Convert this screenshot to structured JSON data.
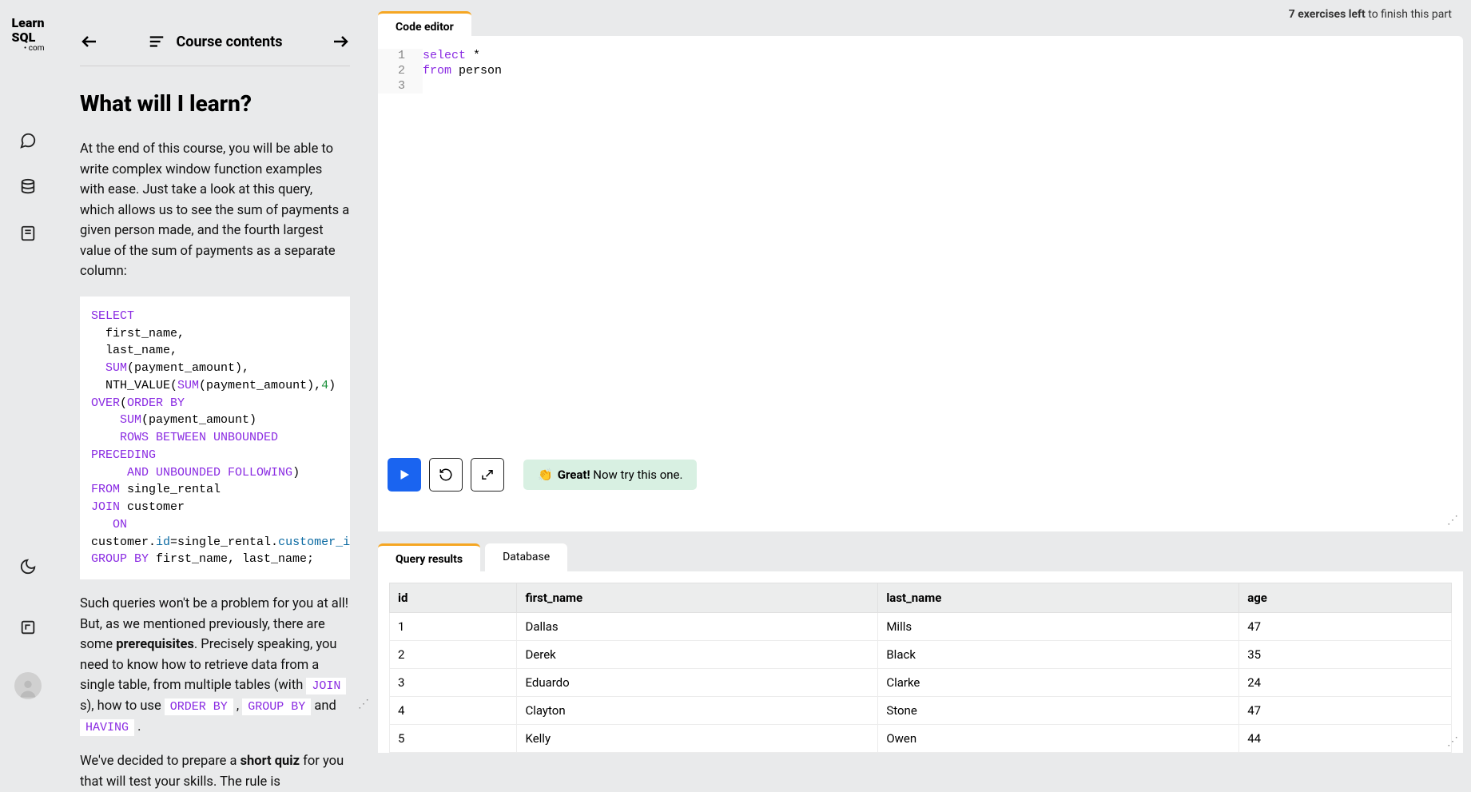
{
  "logo": {
    "line1": "Learn",
    "line2": "SQL",
    "dotcom": "• com"
  },
  "header": {
    "exercises_left_count": "7 exercises left",
    "suffix": " to finish this part"
  },
  "toc": {
    "label": "Course contents"
  },
  "lesson": {
    "title": "What will I learn?",
    "para1": "At the end of this course, you will be able to write complex window function examples with ease. Just take a look at this query, which allows us to see the sum of payments a given person made, and the fourth largest value of the sum of payments as a separate column:",
    "para2a": "Such queries won't be a problem for you at all! But, as we mentioned previously, there are some ",
    "para2b": "prerequisites",
    "para2c": ". Precisely speaking, you need to know how to retrieve data from a single table, from multiple tables (with ",
    "join": "JOIN",
    "para2d": " s), how to use ",
    "orderby": "ORDER BY",
    "para2e": " , ",
    "groupby": "GROUP BY",
    "para2f": " and ",
    "having": "HAVING",
    "para2g": " .",
    "para3a": "We've decided to prepare a ",
    "para3b": "short quiz",
    "para3c": " for you that will test your skills. The rule is"
  },
  "sql_example": {
    "l1_kw": "SELECT",
    "l2": "  first_name,",
    "l3": "  last_name,",
    "l4a": "  ",
    "l4_kw": "SUM",
    "l4b": "(payment_amount),",
    "l5a": "  NTH_VALUE(",
    "l5_kw": "SUM",
    "l5b": "(payment_amount),",
    "l5_num": "4",
    "l5c": ")",
    "l6_kw": "OVER",
    "l6a": "(",
    "l6_kw2": "ORDER BY",
    "l7a": "    ",
    "l7_kw": "SUM",
    "l7b": "(payment_amount)",
    "l8a": "    ",
    "l8_kw": "ROWS BETWEEN UNBOUNDED",
    "l8b_kw": "PRECEDING",
    "l9a": "     ",
    "l9_kw": "AND UNBOUNDED FOLLOWING",
    "l9b": ")",
    "l10_kw": "FROM",
    "l10a": " single_rental",
    "l11_kw": "JOIN",
    "l11a": " customer",
    "l12a": "   ",
    "l12_kw": "ON",
    "l13a": "customer.",
    "l13_col1": "id",
    "l13b": "=single_rental.",
    "l13_col2": "customer_id",
    "l14_kw": "GROUP BY",
    "l14a": " first_name, last_name;"
  },
  "editor": {
    "tab": "Code editor",
    "lines": {
      "n1": "1",
      "n2": "2",
      "n3": "3"
    },
    "code_l1_kw": "select",
    "code_l1_rest": " *",
    "code_l2_kw": "from",
    "code_l2_rest": " person"
  },
  "feedback": {
    "emoji": "👏",
    "strong": "Great!",
    "rest": " Now try this one."
  },
  "results": {
    "tab_active": "Query results",
    "tab_inactive": "Database",
    "columns": {
      "c1": "id",
      "c2": "first_name",
      "c3": "last_name",
      "c4": "age"
    },
    "rows": [
      {
        "id": "1",
        "first_name": "Dallas",
        "last_name": "Mills",
        "age": "47"
      },
      {
        "id": "2",
        "first_name": "Derek",
        "last_name": "Black",
        "age": "35"
      },
      {
        "id": "3",
        "first_name": "Eduardo",
        "last_name": "Clarke",
        "age": "24"
      },
      {
        "id": "4",
        "first_name": "Clayton",
        "last_name": "Stone",
        "age": "47"
      },
      {
        "id": "5",
        "first_name": "Kelly",
        "last_name": "Owen",
        "age": "44"
      }
    ]
  },
  "chart_data": {
    "type": "table",
    "title": "Query results",
    "columns": [
      "id",
      "first_name",
      "last_name",
      "age"
    ],
    "rows": [
      [
        1,
        "Dallas",
        "Mills",
        47
      ],
      [
        2,
        "Derek",
        "Black",
        35
      ],
      [
        3,
        "Eduardo",
        "Clarke",
        24
      ],
      [
        4,
        "Clayton",
        "Stone",
        47
      ],
      [
        5,
        "Kelly",
        "Owen",
        44
      ]
    ]
  }
}
